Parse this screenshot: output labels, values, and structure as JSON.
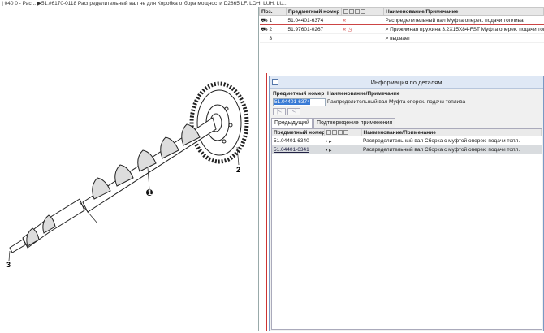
{
  "breadcrumb": "] 040 0 - Рас... ▶51.#6170-0118  Распределительный вал не для Коробка отбора мощности D2865 LF. LOH. LUH. LU...",
  "parts_table": {
    "headers": [
      "Поз.",
      "Предметный номер",
      "",
      "Наименование/Примечание"
    ],
    "rows": [
      {
        "pos": "1",
        "number": "51.04401-6374",
        "flag": "«",
        "name": "Распределительный вал Муфта оперек. подачи топлива"
      },
      {
        "pos": "2",
        "number": "51.97601-0267",
        "flag": "«",
        "name": "> Прижимная пружина  3.2X15X84-FST Муфта оперек. подачи топлива"
      },
      {
        "pos": "3",
        "number": "",
        "flag": "",
        "name": "> выдвает"
      }
    ]
  },
  "drawing": {
    "labels": [
      "1",
      "2",
      "3"
    ]
  },
  "dialog": {
    "title": "Информация по деталям",
    "header_number": "Предметный номер",
    "header_name": "Наименование/Примечание",
    "part_number": "51.04401-6374",
    "part_name": "Распределительный вал Муфта оперек. подачи топлива",
    "nav_first": "|<",
    "nav_prev": "<",
    "tabs": [
      "Предыдущий",
      "Подтверждение применения"
    ],
    "sub_headers": [
      "Предметный номер",
      "",
      "Наименование/Примечание"
    ],
    "sub_rows": [
      {
        "number": "51.04401-6340",
        "icons": "• ▸",
        "name": "Распределительный вал Сборка с муфтой оперек. подачи топл."
      },
      {
        "number": "51.04401-6341",
        "icons": "• ▸",
        "name": "Распределительный вал Сборка с муфтой оперек. подачи топл."
      }
    ]
  }
}
